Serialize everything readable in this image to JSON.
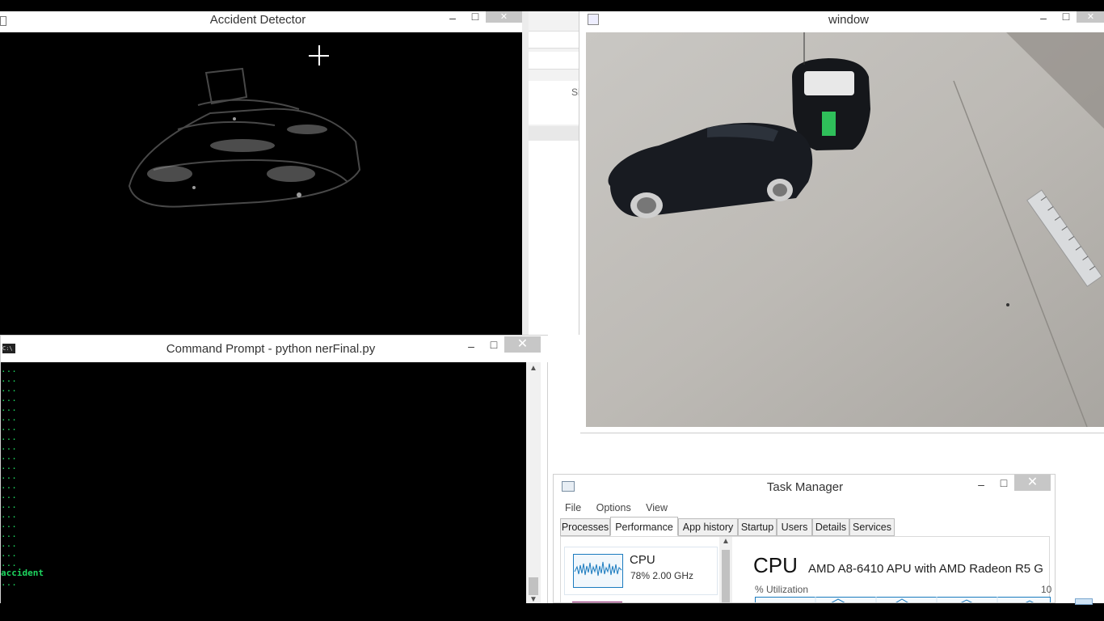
{
  "accident_window": {
    "title": "Accident Detector",
    "controls": {
      "minimize": "–",
      "maximize": "□",
      "close": "✕"
    }
  },
  "cmd_window": {
    "title": "Command Prompt - python  nerFinal.py",
    "icon_label": "C:\\",
    "controls": {
      "minimize": "–",
      "maximize": "□",
      "close": "✕"
    },
    "lines": [
      "...",
      "...",
      "...",
      "...",
      "...",
      "...",
      "...",
      "...",
      "...",
      "...",
      "...",
      "...",
      "...",
      "...",
      "...",
      "...",
      "...",
      "...",
      "...",
      "...",
      "...",
      "accident",
      "..."
    ]
  },
  "video_window": {
    "title": "window",
    "controls": {
      "minimize": "–",
      "maximize": "□",
      "close": "✕"
    }
  },
  "background_window": {
    "partial_label": "Si"
  },
  "task_manager": {
    "title": "Task Manager",
    "controls": {
      "minimize": "–",
      "maximize": "□",
      "close": "✕"
    },
    "menu": [
      "File",
      "Options",
      "View"
    ],
    "tabs": [
      "Processes",
      "Performance",
      "App history",
      "Startup",
      "Users",
      "Details",
      "Services"
    ],
    "active_tab": "Performance",
    "cpu_tile": {
      "label": "CPU",
      "value": "78%  2.00 GHz"
    },
    "cpu_header": {
      "title": "CPU",
      "model": "AMD A8-6410 APU with AMD Radeon R5 G"
    },
    "utilization_label": "% Utilization",
    "utilization_max": "10"
  }
}
